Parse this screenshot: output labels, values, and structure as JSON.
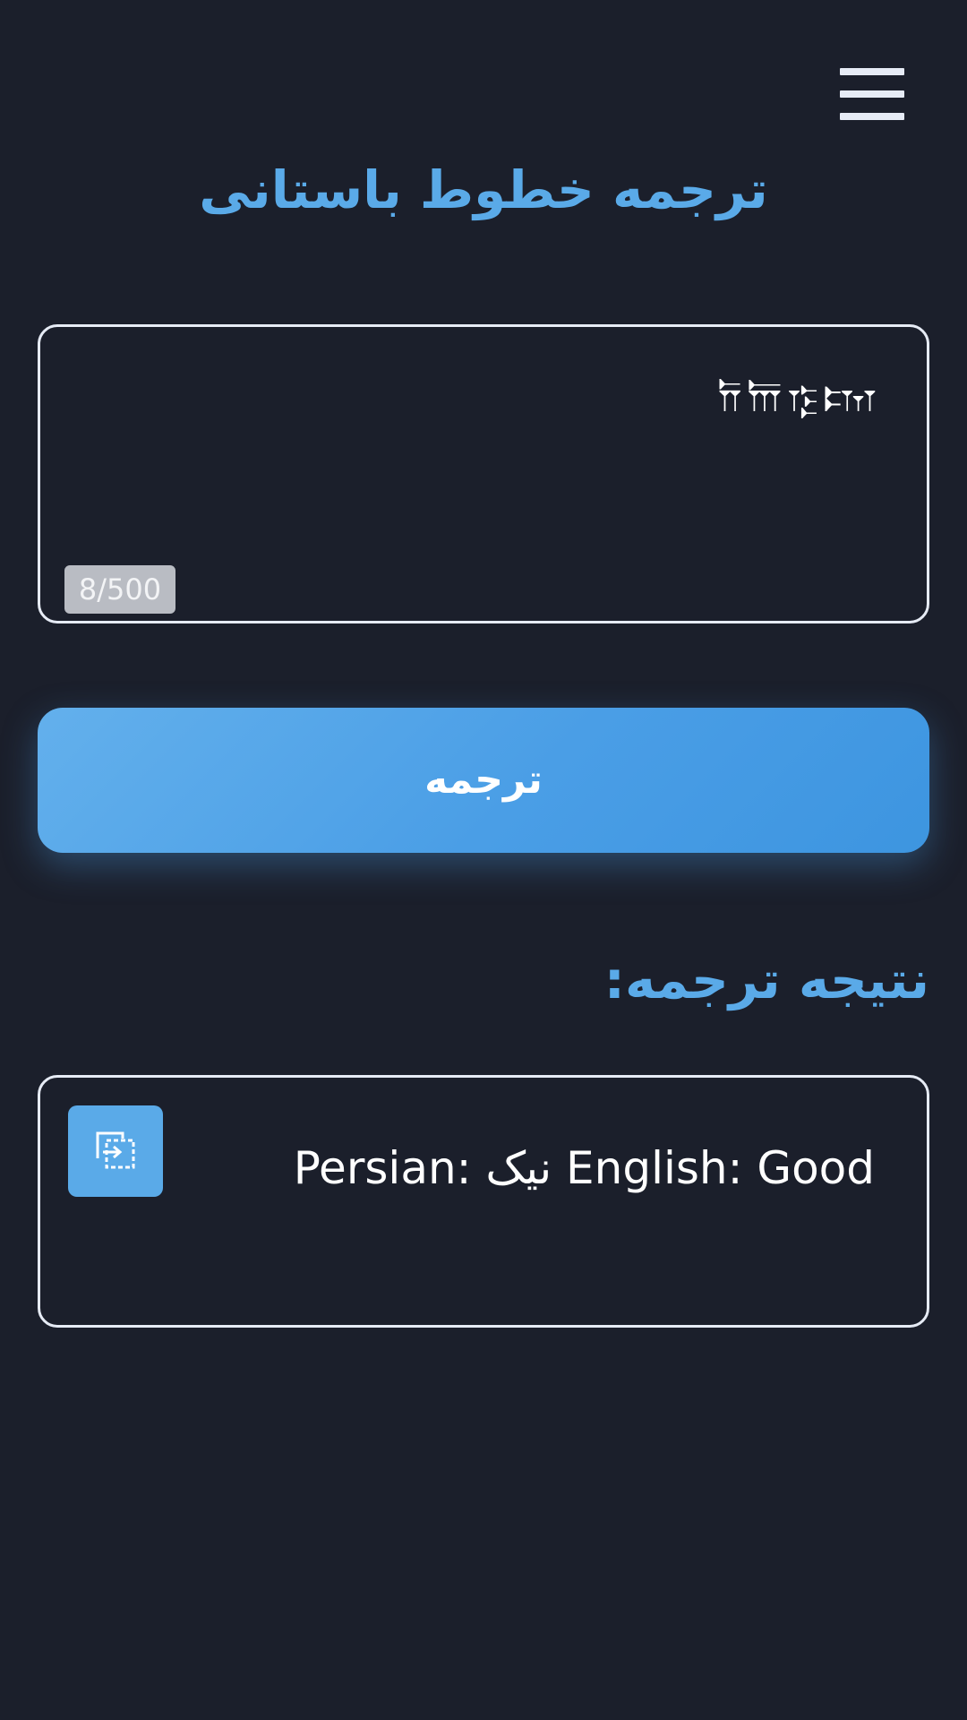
{
  "header": {
    "menu_icon": "hamburger-menu-icon",
    "title": "ترجمه خطوط باستانی"
  },
  "input": {
    "text": "𐎭𐎠𐎿𐎫",
    "char_count": "8/500"
  },
  "translate_button": {
    "label": "ترجمه"
  },
  "result": {
    "heading": "نتیجه ترجمه:",
    "text": "Persian: نیک English: Good",
    "copy_icon": "copy-icon"
  },
  "colors": {
    "background": "#1b1f2b",
    "accent": "#5aaae8",
    "border": "#e6ebf5",
    "counter_badge": "#b9bcc3"
  }
}
